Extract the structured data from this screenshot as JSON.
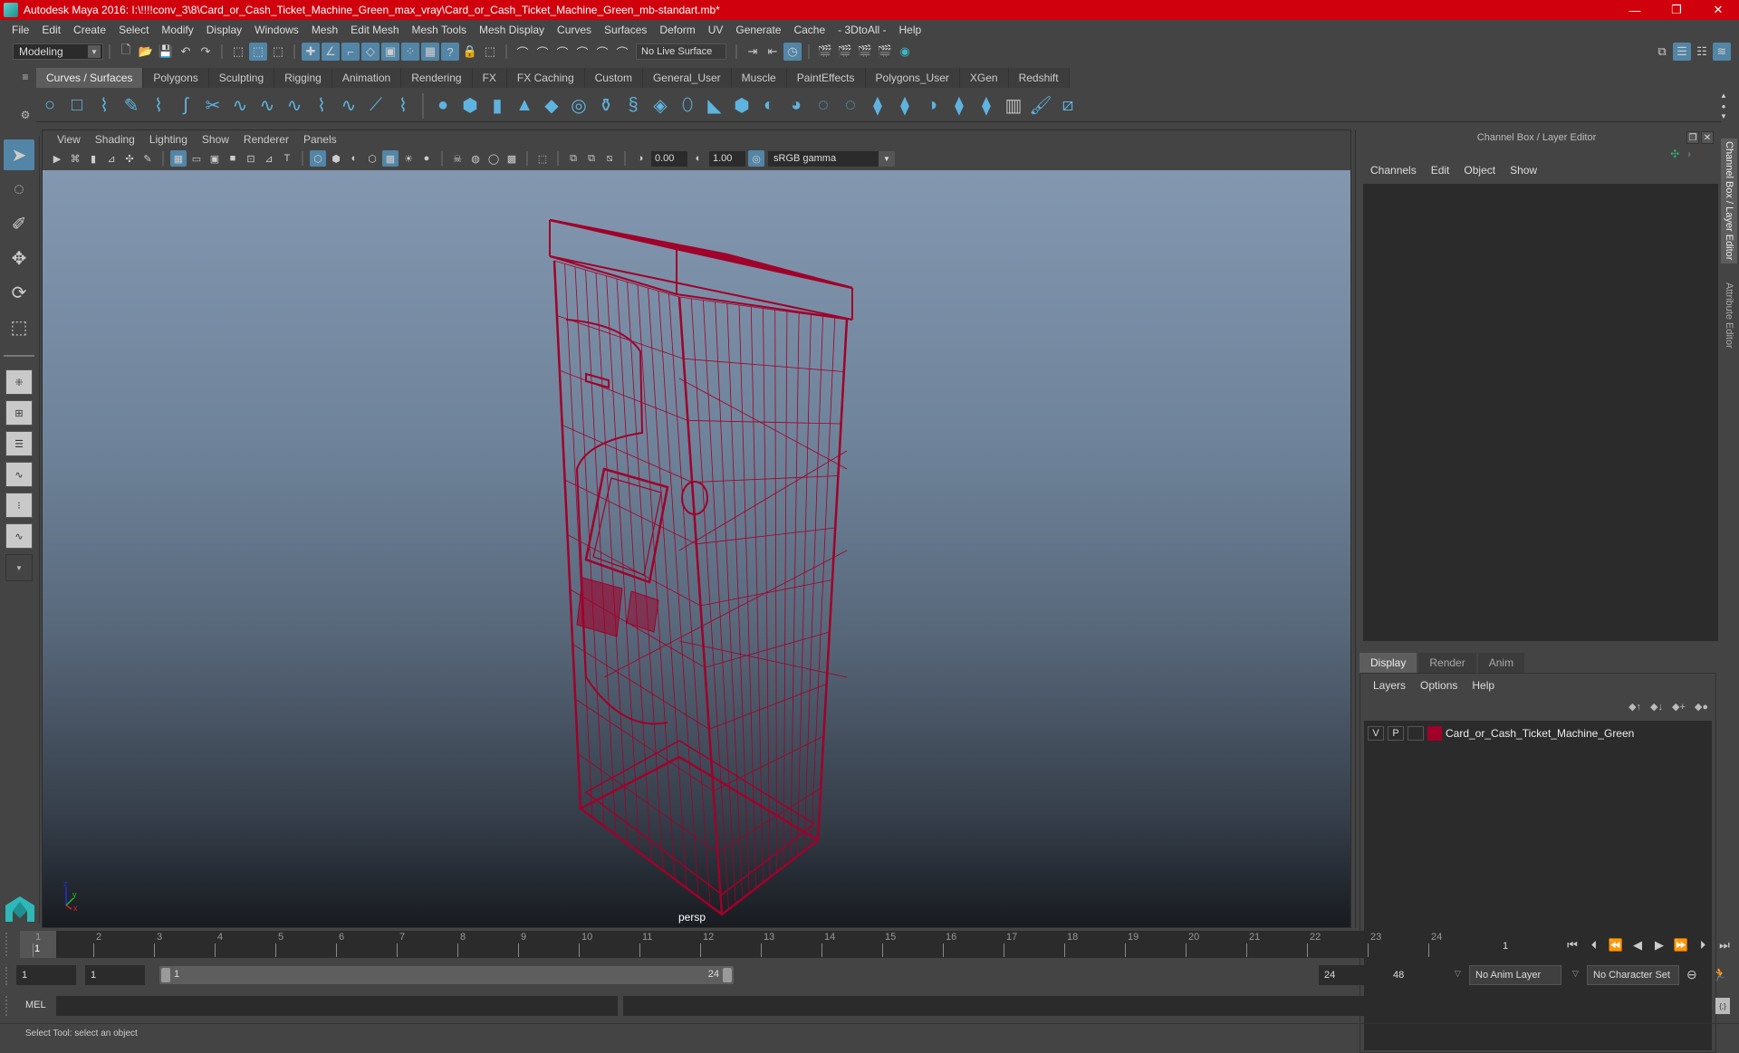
{
  "window": {
    "title": "Autodesk Maya 2016: I:\\!!!!conv_3\\8\\Card_or_Cash_Ticket_Machine_Green_max_vray\\Card_or_Cash_Ticket_Machine_Green_mb-standart.mb*",
    "controls": {
      "minimize": "—",
      "maximize": "❐",
      "close": "✕"
    }
  },
  "menubar": [
    "File",
    "Edit",
    "Create",
    "Select",
    "Modify",
    "Display",
    "Windows",
    "Mesh",
    "Edit Mesh",
    "Mesh Tools",
    "Mesh Display",
    "Curves",
    "Surfaces",
    "Deform",
    "UV",
    "Generate",
    "Cache",
    "- 3DtoAll -",
    "Help"
  ],
  "statusline": {
    "mode": "Modeling",
    "live_surface": "No Live Surface"
  },
  "shelf": {
    "tabs": [
      "Curves / Surfaces",
      "Polygons",
      "Sculpting",
      "Rigging",
      "Animation",
      "Rendering",
      "FX",
      "FX Caching",
      "Custom",
      "General_User",
      "Muscle",
      "PaintEffects",
      "Polygons_User",
      "XGen",
      "Redshift"
    ],
    "active_tab": "Curves / Surfaces"
  },
  "viewport": {
    "menu": [
      "View",
      "Shading",
      "Lighting",
      "Show",
      "Renderer",
      "Panels"
    ],
    "exposure": "0.00",
    "gamma": "1.00",
    "color_space": "sRGB gamma",
    "camera": "persp",
    "axis": {
      "x": "x",
      "y": "y",
      "z": "z"
    },
    "wire_color": "#a0002a"
  },
  "channel_box": {
    "title": "Channel Box / Layer Editor",
    "menu": [
      "Channels",
      "Edit",
      "Object",
      "Show"
    ]
  },
  "layer_editor": {
    "tabs": [
      "Display",
      "Render",
      "Anim"
    ],
    "active_tab": "Display",
    "menu": [
      "Layers",
      "Options",
      "Help"
    ],
    "layers": [
      {
        "visible": "V",
        "playback": "P",
        "color": "#a0002a",
        "name": "Card_or_Cash_Ticket_Machine_Green"
      }
    ]
  },
  "side_tabs": [
    "Channel Box / Layer Editor",
    "Attribute Editor"
  ],
  "timeline": {
    "ticks": [
      "1",
      "2",
      "3",
      "4",
      "5",
      "6",
      "7",
      "8",
      "9",
      "10",
      "11",
      "12",
      "13",
      "14",
      "15",
      "16",
      "17",
      "18",
      "19",
      "20",
      "21",
      "22",
      "23",
      "24"
    ],
    "current_frame_marker": "1",
    "current_frame": "1"
  },
  "range": {
    "start": "1",
    "playback_start": "1",
    "slider_start": "1",
    "slider_end": "24",
    "playback_end": "24",
    "end": "48",
    "anim_layer": "No Anim Layer",
    "character_set": "No Character Set"
  },
  "command_line": {
    "label": "MEL"
  },
  "help_line": "Select Tool: select an object"
}
